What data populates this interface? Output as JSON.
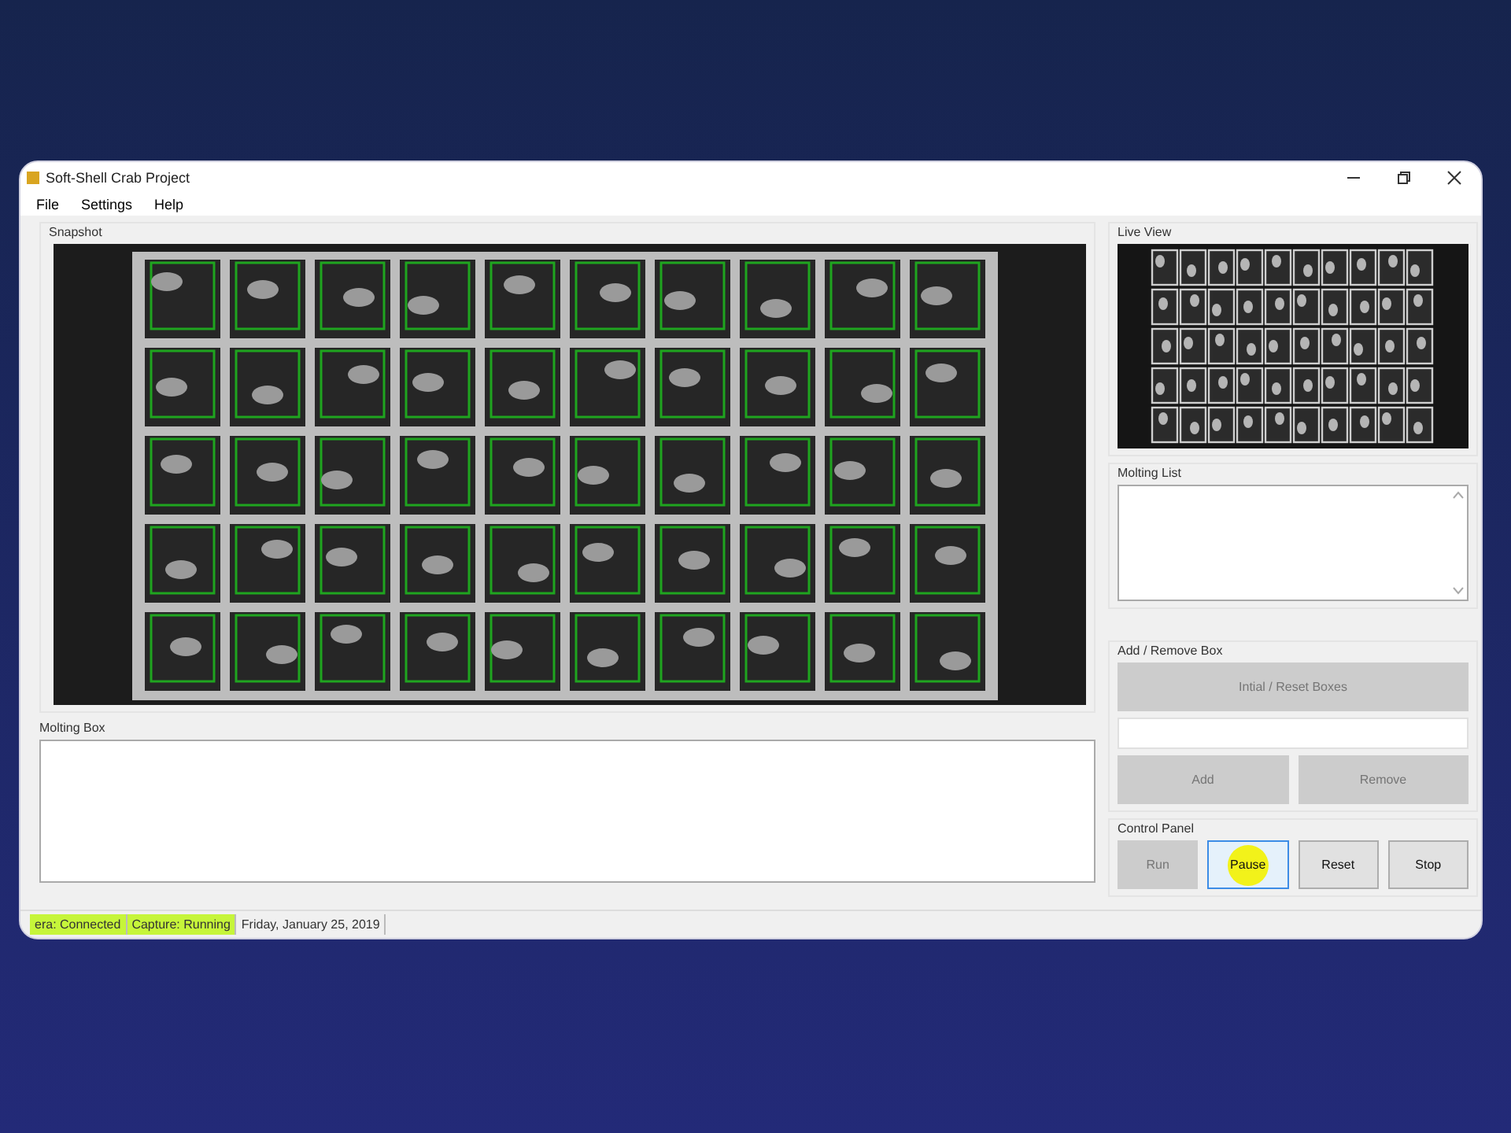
{
  "window": {
    "title": "Soft-Shell Crab Project"
  },
  "menu": [
    {
      "label": "File"
    },
    {
      "label": "Settings"
    },
    {
      "label": "Help"
    }
  ],
  "snapshot": {
    "title": "Snapshot"
  },
  "molting_box": {
    "title": "Molting Box"
  },
  "live_view": {
    "title": "Live View"
  },
  "molting_list": {
    "title": "Molting List"
  },
  "add_remove": {
    "title": "Add / Remove Box",
    "buttons": [
      {
        "label": "Intial / Reset Boxes",
        "disabled": true
      },
      {
        "label": "Add",
        "disabled": true
      },
      {
        "label": "Remove",
        "disabled": true
      }
    ]
  },
  "control_panel": {
    "title": "Control Panel",
    "buttons": [
      {
        "label": "Run",
        "disabled": true,
        "focused": false
      },
      {
        "label": "Pause",
        "disabled": false,
        "focused": true
      },
      {
        "label": "Reset",
        "disabled": false,
        "focused": false
      },
      {
        "label": "Stop",
        "disabled": false,
        "focused": false
      }
    ]
  },
  "status_bar": [
    {
      "text": "era: Connected",
      "color": "#c6f53a"
    },
    {
      "text": "Capture: Running",
      "color": "#c6f53a"
    },
    {
      "text": "Friday, January 25, 2019"
    }
  ]
}
